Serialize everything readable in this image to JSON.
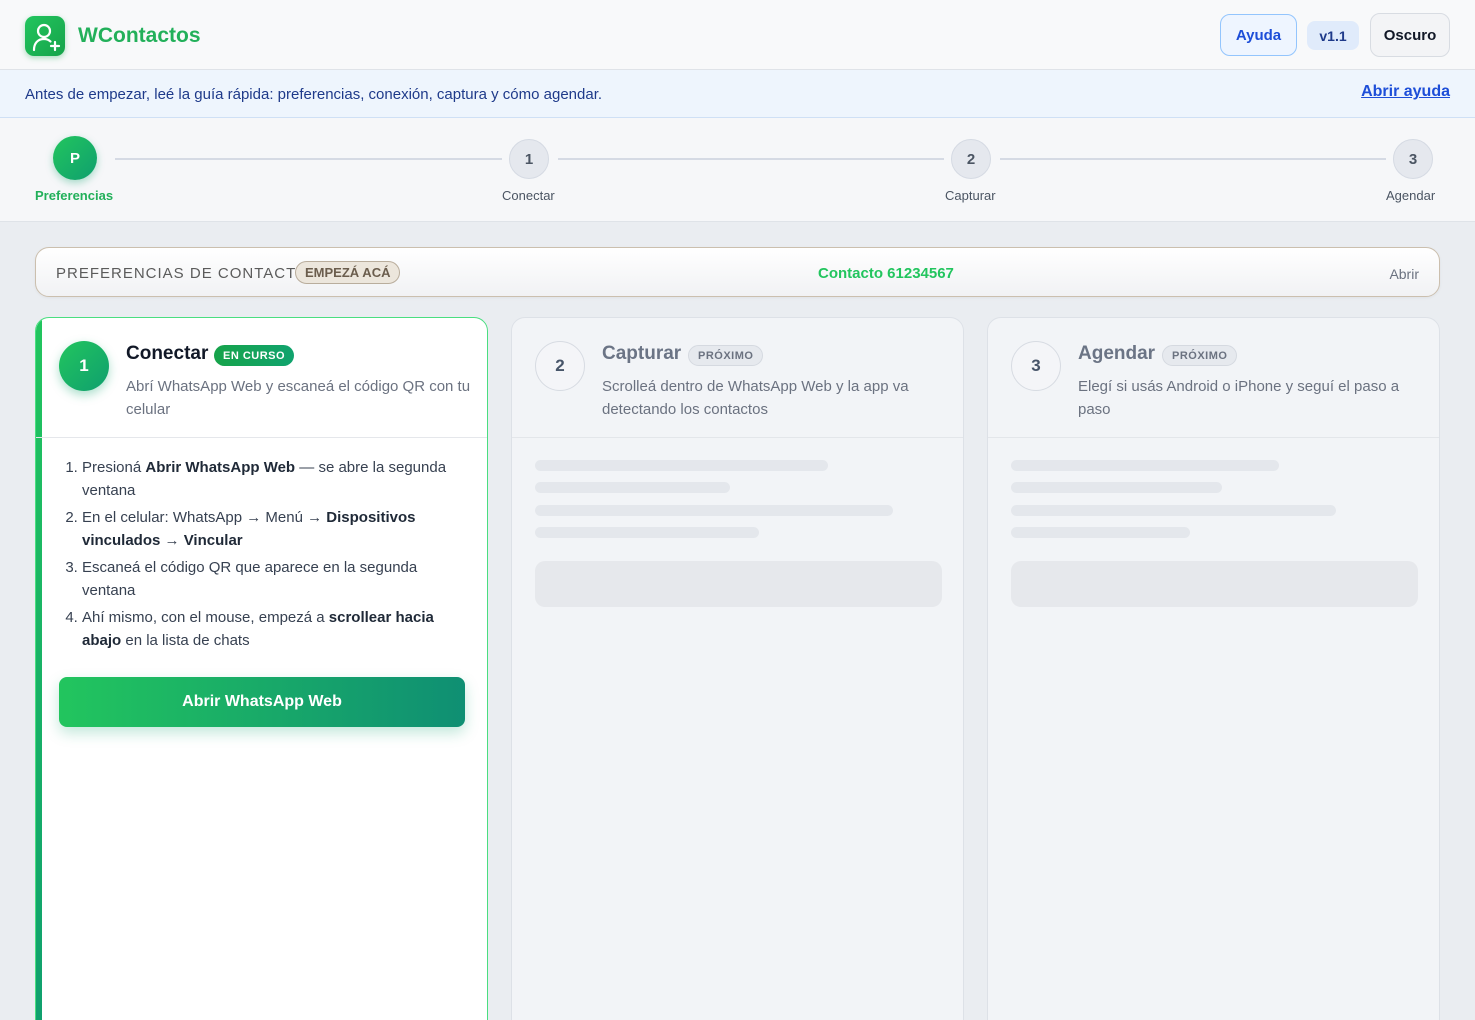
{
  "header": {
    "app_title": "WContactos",
    "help_label": "Ayuda",
    "version": "v1.1",
    "theme_label": "Oscuro"
  },
  "guide": {
    "text": "Antes de empezar, leé la guía rápida: preferencias, conexión, captura y cómo agendar.",
    "link": "Abrir ayuda"
  },
  "stepper": {
    "steps": [
      {
        "marker": "P",
        "label": "Preferencias",
        "active": true
      },
      {
        "marker": "1",
        "label": "Conectar",
        "active": false
      },
      {
        "marker": "2",
        "label": "Capturar",
        "active": false
      },
      {
        "marker": "3",
        "label": "Agendar",
        "active": false
      }
    ]
  },
  "preferences": {
    "title": "PREFERENCIAS DE CONTACTO",
    "badge": "EMPEZÁ ACÁ",
    "contact": "Contacto 61234567",
    "open_label": "Abrir"
  },
  "cards": [
    {
      "number": "1",
      "title": "Conectar",
      "badge": "EN CURSO",
      "description": "Abrí WhatsApp Web y escaneá el código QR con tu celular",
      "instructions": [
        [
          {
            "t": "Presioná "
          },
          {
            "b": "Abrir WhatsApp Web"
          },
          {
            "t": " — se abre la segunda ventana"
          }
        ],
        [
          {
            "t": "En el celular: WhatsApp → Menú → "
          },
          {
            "b": "Dispositivos vinculados"
          },
          {
            "t": " → "
          },
          {
            "b": "Vincular"
          }
        ],
        [
          {
            "t": "Escaneá el código QR que aparece en la segunda ventana"
          }
        ],
        [
          {
            "t": "Ahí mismo, con el mouse, empezá a "
          },
          {
            "b": "scrollear hacia abajo"
          },
          {
            "t": " en la lista de chats"
          }
        ]
      ],
      "button": "Abrir WhatsApp Web"
    },
    {
      "number": "2",
      "title": "Capturar",
      "badge": "PRÓXIMO",
      "description": "Scrolleá dentro de WhatsApp Web y la app va detectando los contactos"
    },
    {
      "number": "3",
      "title": "Agendar",
      "badge": "PRÓXIMO",
      "description": "Elegí si usás Android o iPhone y seguí el paso a paso"
    }
  ],
  "colors": {
    "brand_green": "#22c55e",
    "brand_green_dark": "#0f9f6e",
    "link_blue": "#1d4ed8"
  },
  "icons": {
    "logo": "user-plus-icon"
  }
}
